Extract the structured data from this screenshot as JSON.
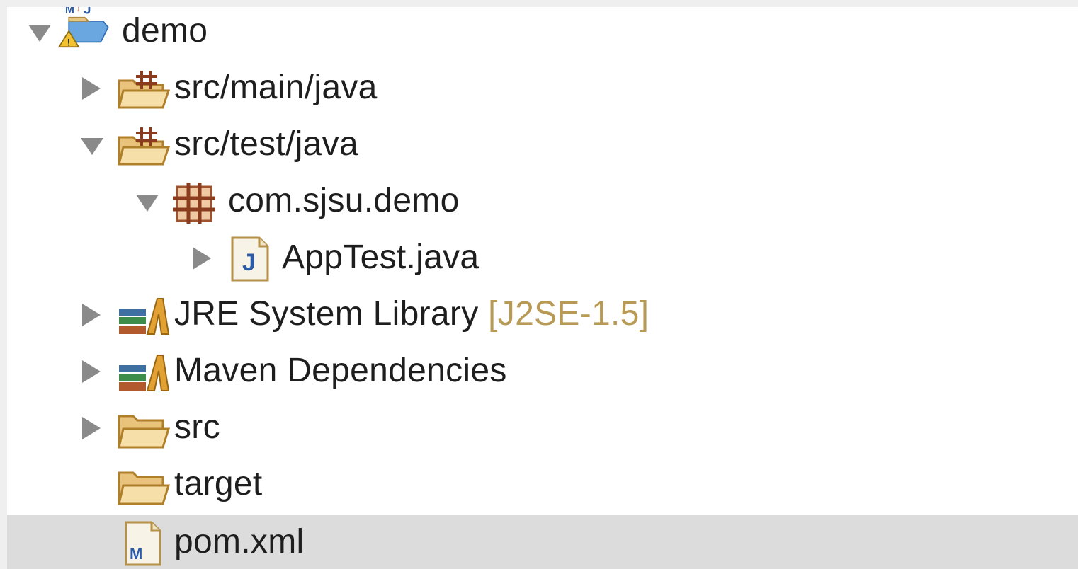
{
  "project_explorer": {
    "tree": [
      {
        "label": "demo",
        "expanded": true,
        "icon": "maven-project-warning-icon"
      },
      {
        "label": "src/main/java",
        "expanded": false,
        "icon": "source-folder-icon"
      },
      {
        "label": "src/test/java",
        "expanded": true,
        "icon": "source-folder-icon"
      },
      {
        "label": "com.sjsu.demo",
        "expanded": true,
        "icon": "package-icon"
      },
      {
        "label": "AppTest.java",
        "expanded": false,
        "icon": "java-file-icon"
      },
      {
        "label": "JRE System Library",
        "decoration": "[J2SE-1.5]",
        "expanded": false,
        "icon": "library-icon"
      },
      {
        "label": "Maven Dependencies",
        "expanded": false,
        "icon": "library-icon"
      },
      {
        "label": "src",
        "expanded": false,
        "icon": "folder-icon"
      },
      {
        "label": "target",
        "icon": "folder-icon"
      },
      {
        "label": "pom.xml",
        "icon": "pom-file-icon",
        "selected": true
      }
    ]
  }
}
